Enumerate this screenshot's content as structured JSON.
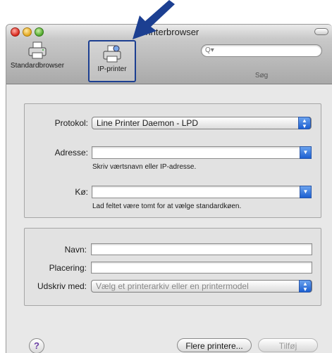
{
  "window": {
    "title": "Printerbrowser"
  },
  "toolbar": {
    "items": [
      {
        "label": "Standardbrowser",
        "icon": "printer-icon"
      },
      {
        "label": "IP-printer",
        "icon": "ip-printer-icon"
      }
    ],
    "search": {
      "placeholder": "",
      "label": "Søg"
    }
  },
  "connection": {
    "protocol_label": "Protokol:",
    "protocol_value": "Line Printer Daemon - LPD",
    "address_label": "Adresse:",
    "address_value": "",
    "address_hint": "Skriv værtsnavn eller IP-adresse.",
    "queue_label": "Kø:",
    "queue_value": "",
    "queue_hint": "Lad feltet være tomt for at vælge standardkøen."
  },
  "details": {
    "name_label": "Navn:",
    "name_value": "",
    "location_label": "Placering:",
    "location_value": "",
    "printwith_label": "Udskriv med:",
    "printwith_value": "Vælg et printerarkiv eller en printermodel"
  },
  "footer": {
    "help_symbol": "?",
    "more_printers": "Flere printere...",
    "add": "Tilføj"
  },
  "colors": {
    "annotation_arrow": "#1c3f91",
    "accent": "#1c5fd1"
  }
}
